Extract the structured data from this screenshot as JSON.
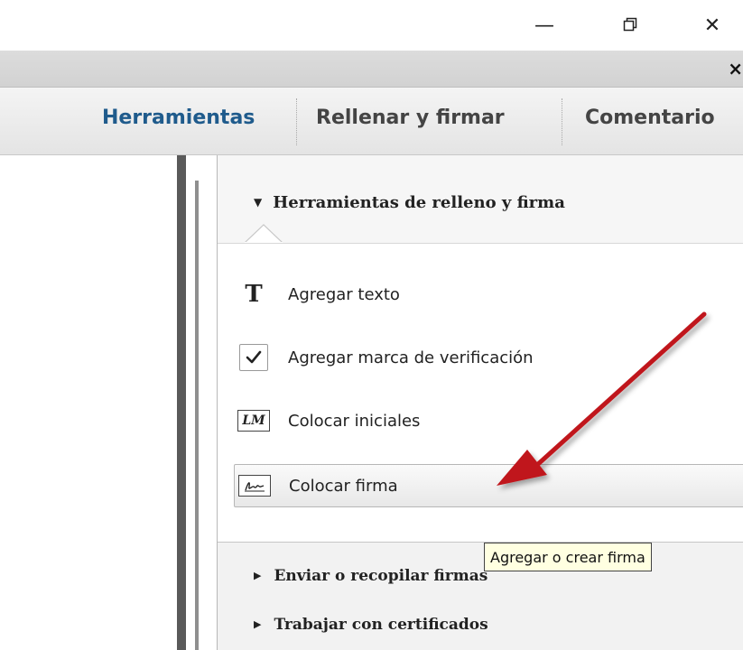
{
  "window": {
    "minimize_glyph": "—",
    "restore_glyph": "⧉",
    "close_glyph": "✕",
    "document_close_glyph": "×"
  },
  "tabs": [
    {
      "label": "Herramientas"
    },
    {
      "label": "Rellenar y firmar"
    },
    {
      "label": "Comentario"
    }
  ],
  "panel": {
    "section_title": "Herramientas de relleno y firma",
    "tools": [
      {
        "label": "Agregar texto",
        "icon": "text-icon"
      },
      {
        "label": "Agregar marca de verificación",
        "icon": "checkmark-icon"
      },
      {
        "label": "Colocar iniciales",
        "icon": "initials-icon",
        "icon_text": "LM"
      },
      {
        "label": "Colocar firma",
        "icon": "signature-icon"
      }
    ],
    "subsections": [
      {
        "label": "Enviar o recopilar firmas"
      },
      {
        "label": "Trabajar con certificados"
      }
    ]
  },
  "tooltip": {
    "text": "Agregar o crear firma"
  },
  "colors": {
    "active_tab": "#1f5b8c",
    "arrow": "#c0151a",
    "tooltip_bg": "#ffffe1"
  }
}
